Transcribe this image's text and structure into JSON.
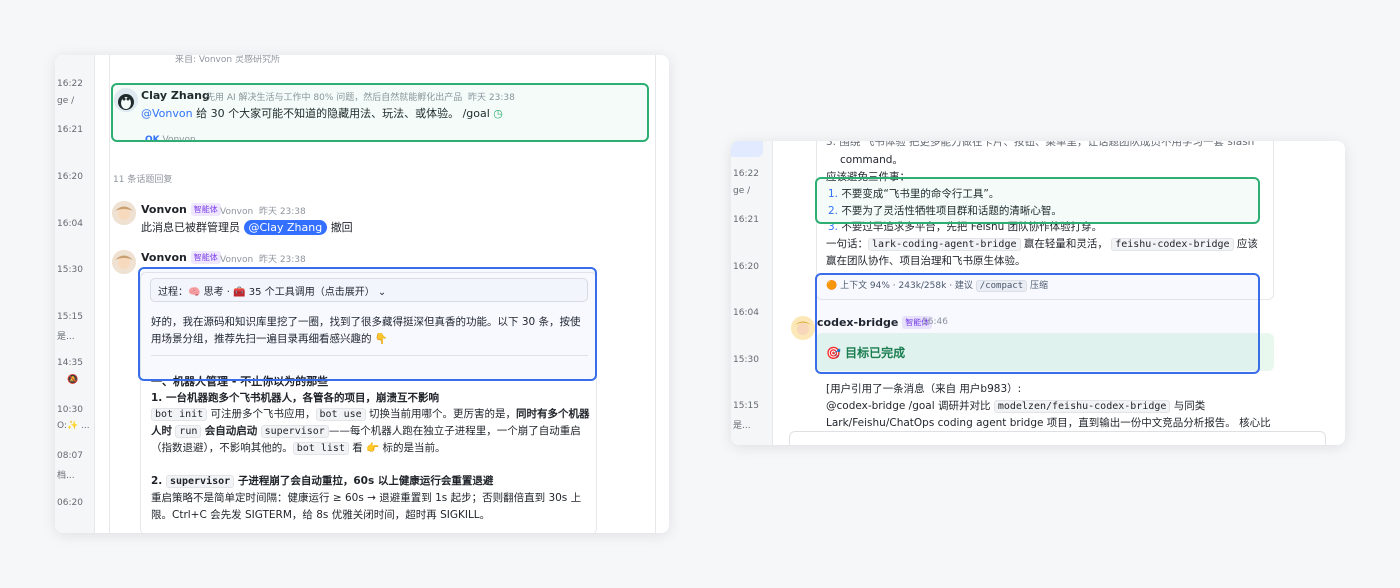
{
  "left_panel": {
    "rail": [
      "16:22",
      "ge /",
      "16:21",
      "16:20",
      "16:04",
      "15:30",
      "15:15",
      "是...",
      "14:35",
      "10:30",
      "O:✨ ...",
      "08:07",
      "档...",
      "06:20"
    ],
    "top_snippet": "来自: Vonvon 灵感研究所",
    "root_message": {
      "sender": "Clay Zhang",
      "subtitle": "先用 AI 解决生活与工作中 80% 问题，然后自然就能孵化出产品",
      "time": "昨天 23:38",
      "mention": "@Vonvon",
      "text": " 给 30 个大家可能不知道的隐藏用法、玩法、或体验。 /goal",
      "reaction_label": "OK",
      "reaction_user": "Vonvon"
    },
    "reply_count": "11 条话题回复",
    "reply1": {
      "sender": "Vonvon",
      "tag": "智能体",
      "name": "Vonvon",
      "time": "昨天 23:38",
      "text_pre": "此消息已被群管理员",
      "mention": "@Clay Zhang",
      "text_post": "撤回"
    },
    "reply2": {
      "sender": "Vonvon",
      "tag": "智能体",
      "name": "Vonvon",
      "time": "昨天 23:38",
      "process_label": "过程：🧠 思考 · 🧰 35 个工具调用（点击展开）",
      "intro_line1": "好的，我在源码和知识库里挖了一圈，找到了很多藏得挺深但真香的功能。以下 30 条，按使",
      "intro_line2": "用场景分组，推荐先扫一遍目录再细看感兴趣的 👇",
      "section_heading": "一、机器人管理 - 不止你以为的那些",
      "item1_title": "1. 一台机器跑多个飞书机器人，各管各的项目，崩溃互不影响",
      "item1_l1_code1": "bot init",
      "item1_l1_text1": "可注册多个飞书应用，",
      "item1_l1_code2": "bot use",
      "item1_l1_text2": "切换当前用哪个。更厉害的是，",
      "item1_l1_bold": "同时有多个机器",
      "item1_l2_bold1": "人时",
      "item1_l2_code1": "run",
      "item1_l2_bold2": "会自动启动",
      "item1_l2_code2": "supervisor",
      "item1_l2_text": "——每个机器人跑在独立子进程里，一个崩了自动重启",
      "item1_l3_text1": "（指数退避），不影响其他的。",
      "item1_l3_code": "bot list",
      "item1_l3_text2": "看 👉 标的是当前。",
      "item2_num": "2.",
      "item2_code": "supervisor",
      "item2_title": "子进程崩了会自动重拉，60s 以上健康运行会重置退避",
      "item2_l1": "重启策略不是简单定时间隔：健康运行 ≥ 60s → 退避重置到 1s 起步；否则翻倍直到 30s 上",
      "item2_l2": "限。Ctrl+C 会先发 SIGTERM，给 8s 优雅关闭时间，超时再 SIGKILL。"
    }
  },
  "right_panel": {
    "rail": [
      "16:22",
      "ge /",
      "16:21",
      "16:20",
      "16:04",
      "15:30",
      "15:15",
      "是..."
    ],
    "top_partial_line1": "3. 围绕 飞书体验 把更多能力做在卡片、按钮、菜单里，让话题团队成员不用学习一套 slash",
    "top_partial_line2": "command。",
    "avoid_heading": "应该避免三件事：",
    "avoid_items": [
      {
        "num": "1.",
        "text": "不要变成“飞书里的命令行工具”。"
      },
      {
        "num": "2.",
        "text": "不要为了灵活性牺牲项目群和话题的清晰心智。"
      },
      {
        "num": "3.",
        "text": "不要过早追求多平台，先把 Feishu 团队协作体验打穿。"
      }
    ],
    "summary_prefix": "一句话：",
    "summary_code1": "lark-coding-agent-bridge",
    "summary_mid": "赢在轻量和灵活，",
    "summary_code2": "feishu-codex-bridge",
    "summary_suffix": "应该",
    "summary_line2": "赢在团队协作、项目治理和飞书原生体验。",
    "context_prefix": "🟠 上下文 94% · 243k/258k · 建议",
    "context_code": "/compact",
    "context_suffix": "压缩",
    "bot_name": "codex-bridge",
    "bot_tag": "智能体",
    "bot_time": "16:46",
    "goal_done": "🎯 目标已完成",
    "quote_line1": "[用户引用了一条消息（来自 用户b983）:",
    "quote_l2_pre": "@codex-bridge /goal 调研并对比",
    "quote_l2_code": "modelzen/feishu-codex-bridge",
    "quote_l2_post": "与同类",
    "quote_line3": "Lark/Feishu/ChatOps coding agent bridge 项目，直到输出一份中文竞品分析报告。 核心比"
  },
  "colors": {
    "highlight_green": "#2eae72",
    "highlight_blue": "#3a6ee8",
    "agent_tag_bg": "#efe7fd",
    "agent_tag_text": "#7a3be8",
    "mention_blue": "#3370ff",
    "success_green": "#e8f8ee"
  }
}
